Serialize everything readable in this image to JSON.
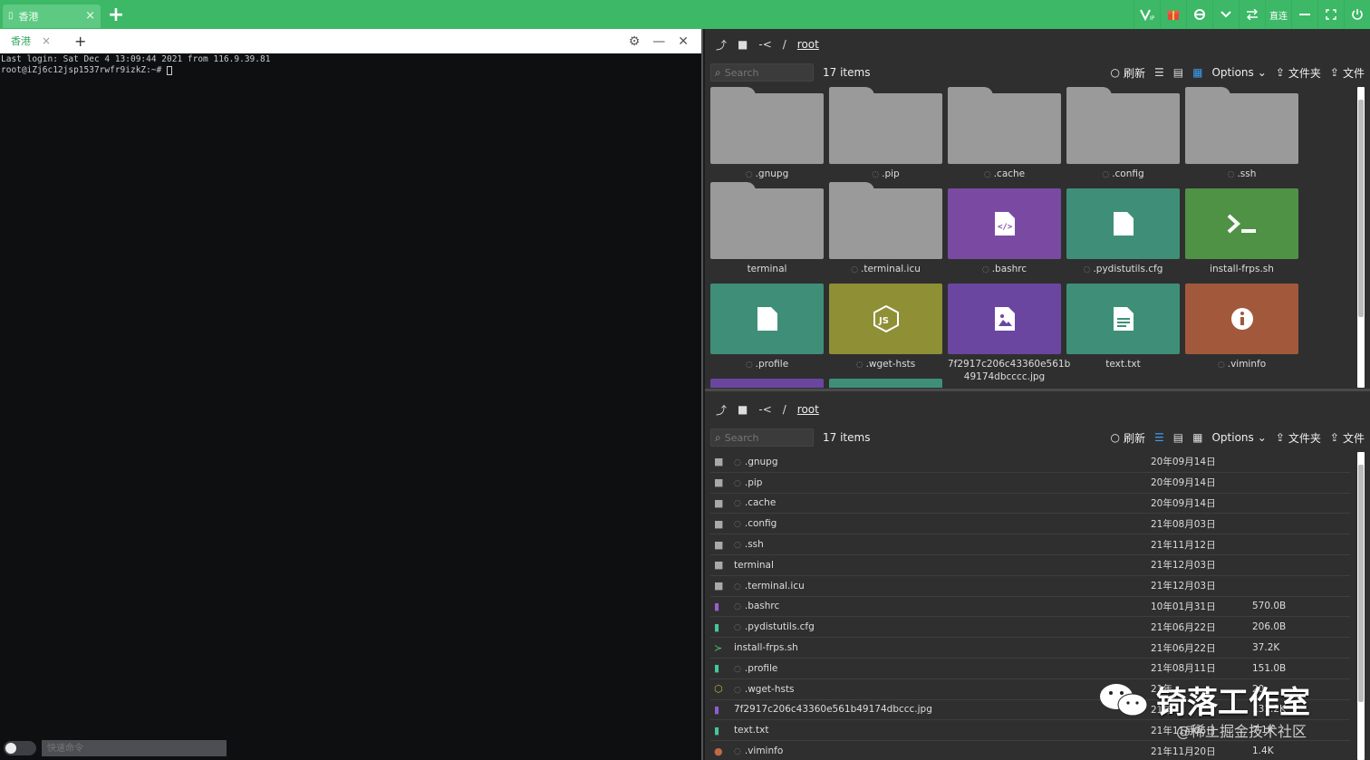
{
  "window": {
    "tab_label": "香港",
    "tab_close": "×",
    "add": "+",
    "toolbar_text_btn": "直连"
  },
  "terminal": {
    "tab_label": "香港",
    "tab_close": "×",
    "add": "+",
    "lines": [
      "Last login: Sat Dec  4 13:09:44 2021 from 116.9.39.81",
      "root@iZj6c12jsp1537rwfr9izkZ:~# "
    ],
    "cmd_placeholder": "快速命令"
  },
  "files_grid": {
    "path_up": "-<",
    "path_sep": "/",
    "path_root": "root",
    "search_placeholder": "Search",
    "items_count": "17 items",
    "refresh": "刷新",
    "options": "Options",
    "folder_btn": "文件夹",
    "file_btn": "文件",
    "items": [
      {
        "name": ".gnupg",
        "hidden": true,
        "kind": "folder"
      },
      {
        "name": ".pip",
        "hidden": true,
        "kind": "folder"
      },
      {
        "name": ".cache",
        "hidden": true,
        "kind": "folder"
      },
      {
        "name": ".config",
        "hidden": true,
        "kind": "folder"
      },
      {
        "name": ".ssh",
        "hidden": true,
        "kind": "folder"
      },
      {
        "name": "terminal",
        "hidden": false,
        "kind": "folder"
      },
      {
        "name": ".terminal.icu",
        "hidden": true,
        "kind": "folder"
      },
      {
        "name": ".bashrc",
        "hidden": true,
        "kind": "code",
        "color": "#7a4aa3"
      },
      {
        "name": ".pydistutils.cfg",
        "hidden": true,
        "kind": "file",
        "color": "#3f8f78"
      },
      {
        "name": "install-frps.sh",
        "hidden": false,
        "kind": "shell",
        "color": "#4f9245"
      },
      {
        "name": ".profile",
        "hidden": true,
        "kind": "file",
        "color": "#3f8f78"
      },
      {
        "name": ".wget-hsts",
        "hidden": true,
        "kind": "js",
        "color": "#8f8f36"
      },
      {
        "name": "7f2917c206c43360e561b49174dbccc.jpg",
        "hidden": false,
        "kind": "image",
        "color": "#6a46a0"
      },
      {
        "name": "text.txt",
        "hidden": false,
        "kind": "text",
        "color": "#3f8f78"
      },
      {
        "name": ".viminfo",
        "hidden": true,
        "kind": "info",
        "color": "#a2593b"
      }
    ],
    "name_line1": "7f2917c206c43360e561b",
    "name_line2": "49174dbcccc.jpg"
  },
  "files_list": {
    "path_up": "-<",
    "path_sep": "/",
    "path_root": "root",
    "search_placeholder": "Search",
    "items_count": "17 items",
    "refresh": "刷新",
    "options": "Options",
    "folder_btn": "文件夹",
    "file_btn": "文件",
    "rows": [
      {
        "name": ".gnupg",
        "hidden": true,
        "date": "20年09月14日",
        "size": "",
        "kind": "folder"
      },
      {
        "name": ".pip",
        "hidden": true,
        "date": "20年09月14日",
        "size": "",
        "kind": "folder"
      },
      {
        "name": ".cache",
        "hidden": true,
        "date": "20年09月14日",
        "size": "",
        "kind": "folder"
      },
      {
        "name": ".config",
        "hidden": true,
        "date": "21年08月03日",
        "size": "",
        "kind": "folder"
      },
      {
        "name": ".ssh",
        "hidden": true,
        "date": "21年11月12日",
        "size": "",
        "kind": "folder"
      },
      {
        "name": "terminal",
        "hidden": false,
        "date": "21年12月03日",
        "size": "",
        "kind": "folder"
      },
      {
        "name": ".terminal.icu",
        "hidden": true,
        "date": "21年12月03日",
        "size": "",
        "kind": "folder"
      },
      {
        "name": ".bashrc",
        "hidden": true,
        "date": "10年01月31日",
        "size": "570.0B",
        "kind": "code"
      },
      {
        "name": ".pydistutils.cfg",
        "hidden": true,
        "date": "21年06月22日",
        "size": "206.0B",
        "kind": "file"
      },
      {
        "name": "install-frps.sh",
        "hidden": false,
        "date": "21年06月22日",
        "size": "37.2K",
        "kind": "shell"
      },
      {
        "name": ".profile",
        "hidden": true,
        "date": "21年08月11日",
        "size": "151.0B",
        "kind": "file"
      },
      {
        "name": ".wget-hsts",
        "hidden": true,
        "date": "21年",
        "size": "20",
        "kind": "js"
      },
      {
        "name": "7f2917c206c43360e561b49174dbccc.jpg",
        "hidden": false,
        "date": "21年",
        "size": "131.2K",
        "kind": "image"
      },
      {
        "name": "text.txt",
        "hidden": false,
        "date": "21年11月06日",
        "size": "7.1K",
        "kind": "text"
      },
      {
        "name": ".viminfo",
        "hidden": true,
        "date": "21年11月20日",
        "size": "1.4K",
        "kind": "info"
      }
    ]
  },
  "watermark": {
    "title": "锜落工作室",
    "sub": "@稀土掘金技术社区"
  },
  "colors": {
    "topbar": "#3cb866",
    "accent": "#3a9ef0",
    "folder": "#9a9a9b"
  }
}
